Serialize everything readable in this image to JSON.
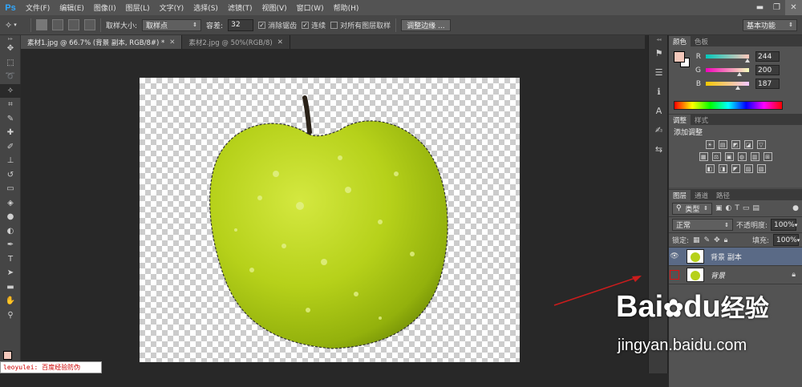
{
  "app": {
    "logo": "Ps"
  },
  "menu": [
    "文件(F)",
    "编辑(E)",
    "图像(I)",
    "图层(L)",
    "文字(Y)",
    "选择(S)",
    "滤镜(T)",
    "视图(V)",
    "窗口(W)",
    "帮助(H)"
  ],
  "window_controls": {
    "minimize": "▬",
    "restore": "❐",
    "close": "✕"
  },
  "options": {
    "sample_size_label": "取样大小:",
    "sample_size_value": "取样点",
    "tolerance_label": "容差:",
    "tolerance_value": "32",
    "anti_alias_label": "消除锯齿",
    "contiguous_label": "连续",
    "sample_all_layers_label": "对所有图层取样",
    "refine_edge_button": "调整边缘 ...",
    "workspace_value": "基本功能"
  },
  "document_tabs": [
    {
      "label": "素材1.jpg @ 66.7% (背景 副本, RGB/8#) *",
      "active": true
    },
    {
      "label": "素材2.jpg @ 50%(RGB/8)",
      "active": false
    }
  ],
  "color_panel": {
    "tabs": [
      "颜色",
      "色板"
    ],
    "foreground_color": "#f4c8bb",
    "sliders": [
      {
        "label": "R",
        "value": "244",
        "fraction": 0.957,
        "gradient": "linear-gradient(90deg,#00c8bb,#ffc8bb)"
      },
      {
        "label": "G",
        "value": "200",
        "fraction": 0.784,
        "gradient": "linear-gradient(90deg,#f400bb,#f4ffbb)"
      },
      {
        "label": "B",
        "value": "187",
        "fraction": 0.733,
        "gradient": "linear-gradient(90deg,#f4c800,#f4c8ff)"
      }
    ]
  },
  "adjustments_panel": {
    "tabs": [
      "调整",
      "样式"
    ],
    "heading": "添加调整",
    "row1": [
      "☀",
      "▤",
      "◩",
      "◪",
      "▽"
    ],
    "row2": [
      "▦",
      "⚖",
      "▣",
      "◍",
      "▥",
      "⊞"
    ],
    "row3": [
      "◧",
      "◨",
      "◤",
      "▨",
      "▧"
    ]
  },
  "layers_panel": {
    "tabs": [
      "图层",
      "通道",
      "路径"
    ],
    "filter_type": "类型",
    "blend_mode": "正常",
    "opacity_label": "不透明度:",
    "opacity_value": "100%",
    "lock_label": "锁定:",
    "fill_label": "填充:",
    "fill_value": "100%",
    "layers": [
      {
        "name": "背景 副本",
        "visible": true,
        "selected": true,
        "locked": false
      },
      {
        "name": "背景",
        "visible": false,
        "selected": false,
        "locked": true
      }
    ]
  },
  "annotation_label": "leoyulei: 百度经验防伪",
  "watermark": {
    "brand": "Bai",
    "brand_du": "du",
    "exp": "经验",
    "url": "jingyan.baidu.com"
  }
}
